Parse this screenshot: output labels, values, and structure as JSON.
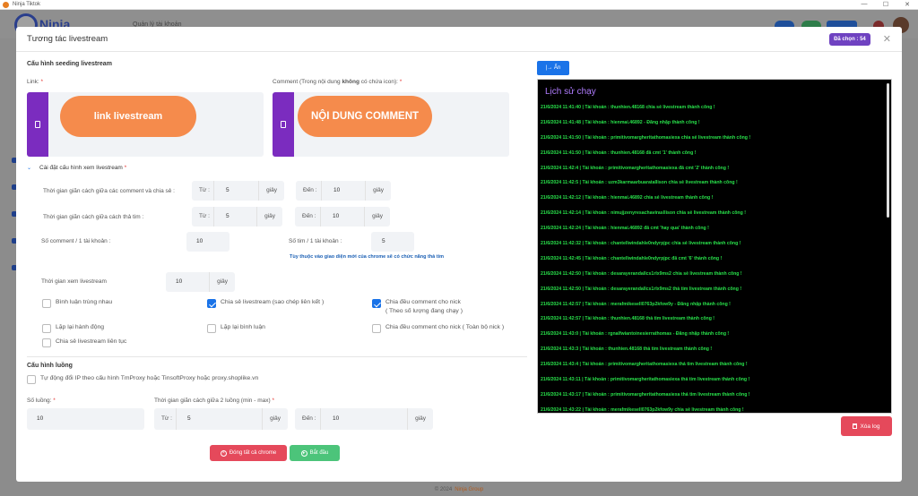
{
  "window": {
    "title": "Ninja Tiktok"
  },
  "background": {
    "logo_text": "Ninja",
    "nav_text": "Quản lý tài khoản",
    "footer_prefix": "© 2024",
    "footer_brand": "Ninja Group"
  },
  "modal": {
    "title": "Tương tác livestream",
    "selected_badge": "Đã chọn : 54",
    "seeding": {
      "section_title": "Cấu hình seeding livestream",
      "link_label": "Link:",
      "link_placeholder": "link livestream",
      "comment_label_pre": "Comment (Trong nội dung ",
      "comment_label_bold": "không",
      "comment_label_post": " có chứa icon):",
      "comment_placeholder": "NỘI DUNG COMMENT",
      "required_mark": "*"
    },
    "watch": {
      "section_title": "Cài đặt cấu hình xem livestream",
      "comment_share_interval_label": "Thời gian giãn cách giữa các comment và chia sẻ :",
      "heart_interval_label": "Thời gian giãn cách giữa cách thả tim :",
      "from_label": "Từ :",
      "to_label": "Đến :",
      "unit": "giây",
      "comment_share_from": "5",
      "comment_share_to": "10",
      "heart_from": "5",
      "heart_to": "10",
      "comments_per_account_label": "Số comment / 1 tài khoản :",
      "comments_per_account": "10",
      "hearts_per_account_label": "Số tim / 1 tài khoản :",
      "hearts_per_account": "5",
      "heart_hint": "Tùy thuộc vào giao diện mới của chrome sẽ có chức năng thả tim",
      "watch_time_label": "Thời gian xem livestream",
      "watch_time": "10",
      "options": {
        "duplicate_comment": {
          "label": "Bình luận trùng nhau",
          "checked": false
        },
        "share_livestream": {
          "label": "Chia sẻ livestream (sao chép liên kết )",
          "checked": true
        },
        "split_comments": {
          "label": "Chia đều comment cho nick",
          "sub": "( Theo số lượng đang chạy )",
          "checked": true
        },
        "repeat_actions": {
          "label": "Lặp lại hành động",
          "checked": false
        },
        "repeat_comments": {
          "label": "Lặp lại bình luận",
          "checked": false
        },
        "split_comments_all": {
          "label": "Chia đều comment cho nick ( Toàn bộ nick )",
          "checked": false
        },
        "share_continuous": {
          "label": "Chia sẻ livestream liên tục",
          "checked": false
        }
      }
    },
    "threads": {
      "section_title": "Cấu hình luồng",
      "auto_ip_label": "Tự động đổi IP theo cấu hình TmProxy hoặc TinsoftProxy hoặc proxy.shoplike.vn",
      "thread_count_label": "Số luồng:",
      "thread_count": "10",
      "thread_interval_label": "Thời gian giãn cách giữa 2 luồng (min - max)",
      "from": "5",
      "to": "10"
    },
    "buttons": {
      "close_all_chrome": "Đóng tất cả chrome",
      "start": "Bắt đầu",
      "hide": "|→ Ẩn",
      "clear_log": "Xóa log"
    },
    "log": {
      "title": "Lịch sử chạy",
      "lines": [
        "21/6/2024 11:41:40 | Tài khoản : thunhien.48168 chia sẻ livestream thành công !",
        "21/6/2024 11:41:48 | Tài khoản : hienmai.46892 - Đăng nhập thành công !",
        "21/6/2024 11:41:50 | Tài khoản : primitivomargheritathomasiexa chia sẻ livestream thành công !",
        "21/6/2024 11:41:50 | Tài khoản : thunhien.48168 đã cmt '1' thành công !",
        "21/6/2024 11:42:4 | Tài khoản : primitivomargheritathomasiexa đã cmt '2' thành công !",
        "21/6/2024 11:42:5 | Tài khoản : uzm3karmaarbuaratallison chia sẻ livestream thành công !",
        "21/6/2024 11:42:12 | Tài khoản : hienmai.46892 chia sẻ livestream thành công !",
        "21/6/2024 11:42:14 | Tài khoản : nimujjzenyresachavirasllison chia sẻ livestream thành công !",
        "21/6/2024 11:42:24 | Tài khoản : hienmai.46892 đã cmt 'hay qua' thành công !",
        "21/6/2024 11:42:32 | Tài khoản : chantellwindahle0ndyrpjpc chia sẻ livestream thành công !",
        "21/6/2024 11:42:45 | Tài khoản : chantellwindahle0ndyrpjpc đã cmt '6' thành công !",
        "21/6/2024 11:42:50 | Tài khoản : desarayerandallcs1rlx9ms2 chia sẻ livestream thành công !",
        "21/6/2024 11:42:50 | Tài khoản : desarayerandallcs1rlx9ms2 thả tim livestream thành công !",
        "21/6/2024 11:42:57 | Tài khoản : merafmikesell0763p2kfow9y - Đăng nhập thành công !",
        "21/6/2024 11:42:57 | Tài khoản : thunhien.48168 thả tim livestream thành công !",
        "21/6/2024 11:43:0 | Tài khoản : rgnalfwiantoinesierrathomas - Đăng nhập thành công !",
        "21/6/2024 11:43:3 | Tài khoản : thunhien.48168 thả tim livestream thành công !",
        "21/6/2024 11:43:4 | Tài khoản : primitivomargheritathomasiexa thả tim livestream thành công !",
        "21/6/2024 11:43:11 | Tài khoản : primitivomargheritathomasiexa thả tim livestream thành công !",
        "21/6/2024 11:43:17 | Tài khoản : primitivomargheritathomasiexa thả tim livestream thành công !",
        "21/6/2024 11:43:22 | Tài khoản : merafmikesell0763p2kfow9y chia sẻ livestream thành công !"
      ]
    }
  },
  "colors": {
    "accent_blue": "#1a73e8",
    "badge_purple": "#6f42c1",
    "log_green": "#28e04a",
    "danger": "#e5495b",
    "success": "#4cc47a"
  }
}
